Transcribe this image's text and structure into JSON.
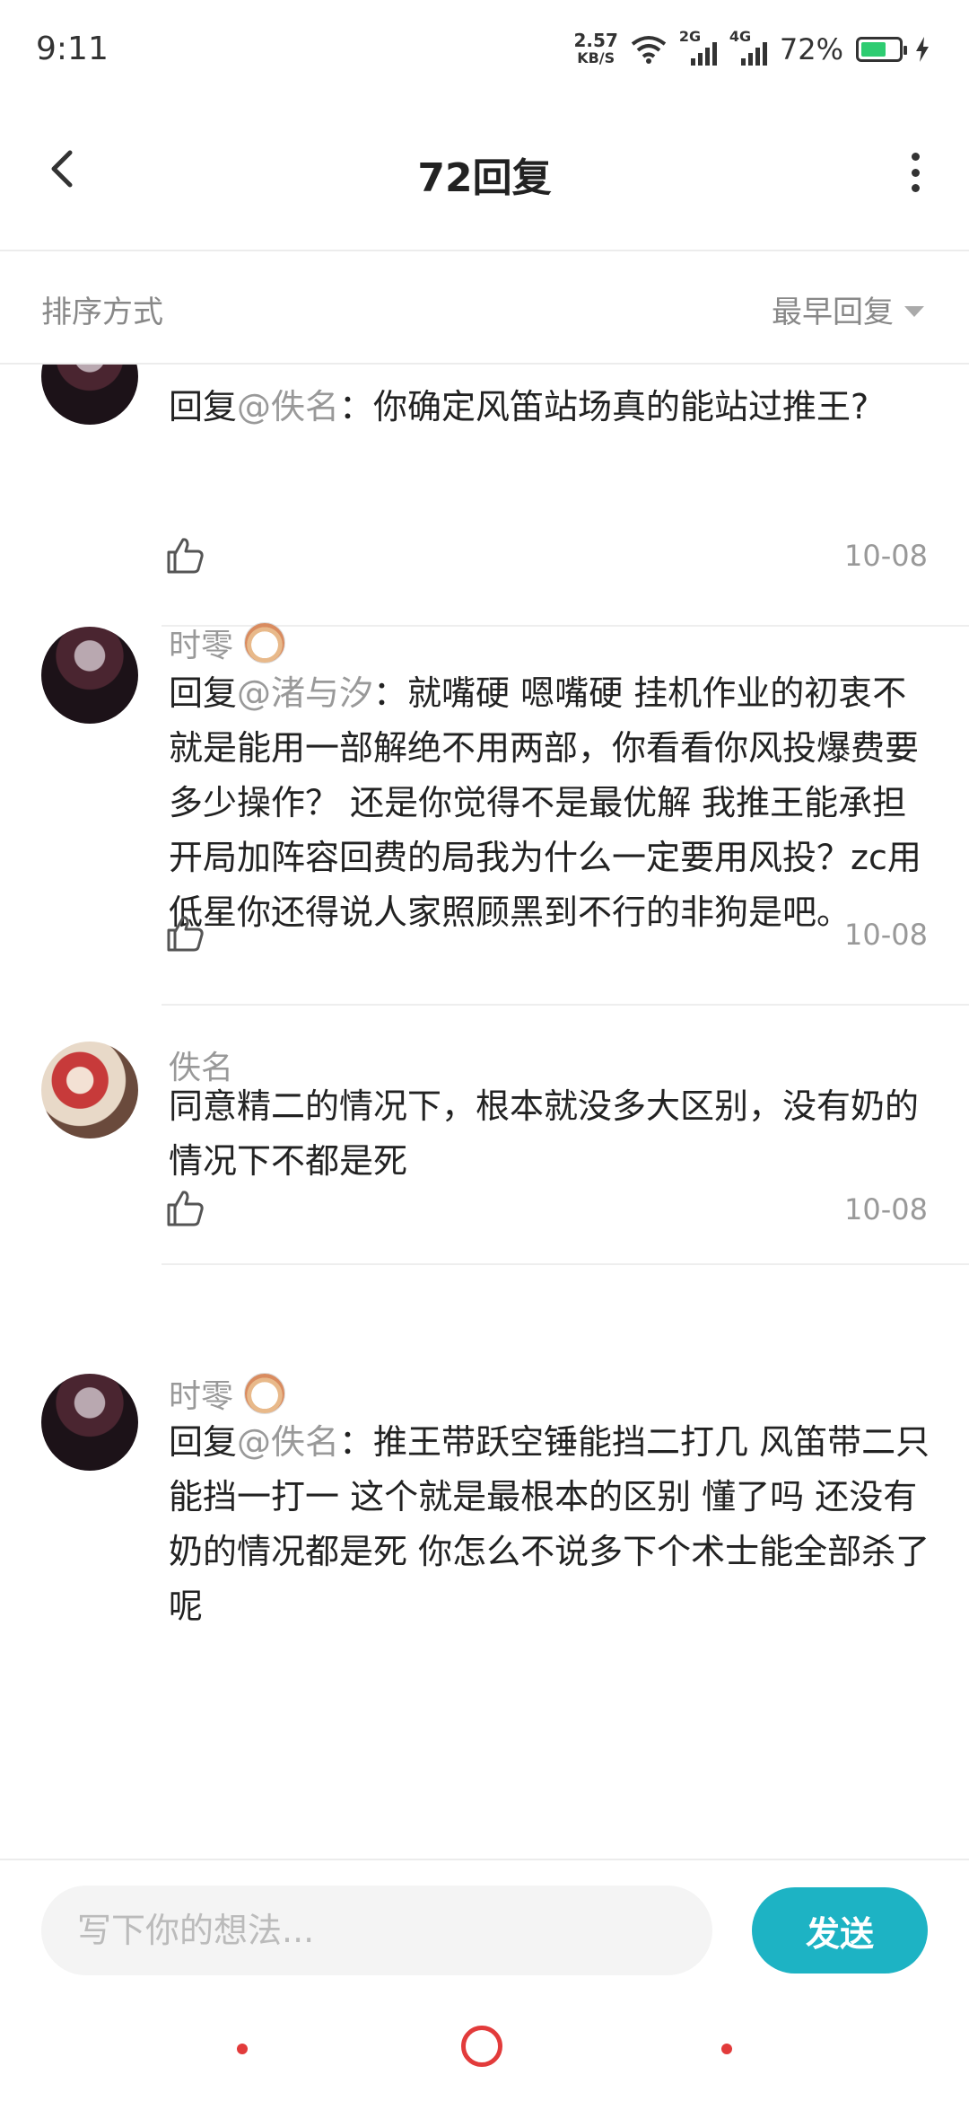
{
  "status_bar": {
    "time": "9:11",
    "net_speed_value": "2.57",
    "net_speed_unit": "KB/S",
    "signal_1_label": "2G",
    "signal_2_label": "4G",
    "battery_text": "72%",
    "battery_level": 0.72
  },
  "header": {
    "title": "72回复"
  },
  "sort_bar": {
    "label": "排序方式",
    "value": "最早回复"
  },
  "replies": [
    {
      "user": "",
      "text_prefix": "回复",
      "mention": "@佚名",
      "text": "：你确定风笛站场真的能站过推王?",
      "date": "10-08"
    },
    {
      "user": "时零",
      "text_prefix": "回复",
      "mention": "@渚与汐",
      "text": "：就嘴硬 嗯嘴硬 挂机作业的初衷不就是能用一部解绝不用两部，你看看你风投爆费要多少操作？ 还是你觉得不是最优解 我推王能承担开局加阵容回费的局我为什么一定要用风投？zc用低星你还得说人家照顾黑到不行的非狗是吧。",
      "date": "10-08"
    },
    {
      "user": "佚名",
      "text": "同意精二的情况下，根本就没多大区别，没有奶的情况下不都是死",
      "date": "10-08"
    },
    {
      "user": "时零",
      "text_prefix": "回复",
      "mention": "@佚名",
      "text": "：推王带跃空锤能挡二打几 风笛带二只能挡一打一 这个就是最根本的区别 懂了吗 还没有奶的情况都是死 你怎么不说多下个术士能全部杀了呢"
    }
  ],
  "composer": {
    "placeholder": "写下你的想法...",
    "send_label": "发送"
  },
  "colors": {
    "accent": "#1db3c4",
    "nav": "#e23b3b",
    "battery": "#2ecc71"
  },
  "icons": [
    "back-arrow-icon",
    "more-vertical-icon",
    "thumbs-up-icon",
    "dropdown-triangle-icon",
    "wifi-icon",
    "battery-icon",
    "charging-icon"
  ]
}
